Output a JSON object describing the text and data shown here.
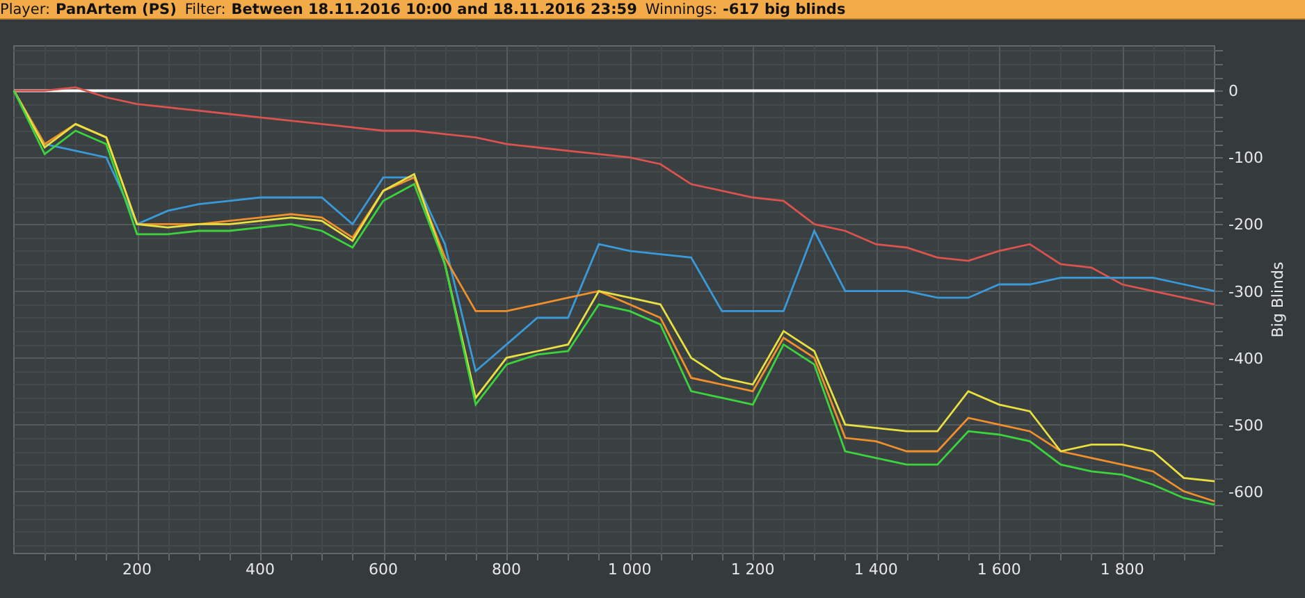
{
  "header": [
    {
      "label": "Player:",
      "value": "PanArtem (PS)"
    },
    {
      "label": "Filter:",
      "value": "Between 18.11.2016 10:00 and 18.11.2016 23:59"
    },
    {
      "label": "Winnings:",
      "value": "-617 big blinds"
    }
  ],
  "chart_data": {
    "type": "line",
    "grid": true,
    "ylabel": "Big Blinds",
    "xlim": [
      0,
      1950
    ],
    "ylim": [
      -693,
      67
    ],
    "xticks": [
      {
        "value": 200,
        "label": "200"
      },
      {
        "value": 400,
        "label": "400"
      },
      {
        "value": 600,
        "label": "600"
      },
      {
        "value": 800,
        "label": "800"
      },
      {
        "value": 1000,
        "label": "1 000"
      },
      {
        "value": 1200,
        "label": "1 200"
      },
      {
        "value": 1400,
        "label": "1 400"
      },
      {
        "value": 1600,
        "label": "1 600"
      },
      {
        "value": 1800,
        "label": "1 800"
      }
    ],
    "yticks": [
      0,
      -100,
      -200,
      -300,
      -400,
      -500,
      -600
    ],
    "x": [
      0,
      50,
      100,
      150,
      200,
      250,
      300,
      350,
      400,
      450,
      500,
      550,
      600,
      650,
      700,
      750,
      800,
      850,
      900,
      950,
      1000,
      1050,
      1100,
      1150,
      1200,
      1250,
      1300,
      1350,
      1400,
      1450,
      1500,
      1550,
      1600,
      1650,
      1700,
      1750,
      1800,
      1850,
      1900,
      1950
    ],
    "series": [
      {
        "color": "#ffffff",
        "values": [
          0,
          0,
          0,
          0,
          0,
          0,
          0,
          0,
          0,
          0,
          0,
          0,
          0,
          0,
          0,
          0,
          0,
          0,
          0,
          0,
          0,
          0,
          0,
          0,
          0,
          0,
          0,
          0,
          0,
          0,
          0,
          0,
          0,
          0,
          0,
          0,
          0,
          0,
          0,
          0
        ]
      },
      {
        "color": "#d9534f",
        "values": [
          0,
          0,
          5,
          -10,
          -20,
          -25,
          -30,
          -35,
          -40,
          -45,
          -50,
          -55,
          -60,
          -60,
          -65,
          -70,
          -80,
          -85,
          -90,
          -95,
          -100,
          -110,
          -140,
          -150,
          -160,
          -165,
          -200,
          -210,
          -230,
          -235,
          -250,
          -255,
          -240,
          -230,
          -260,
          -265,
          -290,
          -300,
          -310,
          -320
        ]
      },
      {
        "color": "#3a9ad9",
        "values": [
          0,
          -80,
          -90,
          -100,
          -200,
          -180,
          -170,
          -165,
          -160,
          -160,
          -160,
          -200,
          -130,
          -130,
          -230,
          -420,
          -380,
          -340,
          -340,
          -230,
          -240,
          -245,
          -250,
          -330,
          -330,
          -330,
          -210,
          -300,
          -300,
          -300,
          -310,
          -310,
          -290,
          -290,
          -280,
          -280,
          -280,
          -280,
          -290,
          -300
        ]
      },
      {
        "color": "#f0902a",
        "values": [
          0,
          -80,
          -50,
          -70,
          -200,
          -200,
          -200,
          -195,
          -190,
          -185,
          -190,
          -220,
          -150,
          -130,
          -250,
          -330,
          -330,
          -320,
          -310,
          -300,
          -320,
          -340,
          -430,
          -440,
          -450,
          -370,
          -400,
          -520,
          -525,
          -540,
          -540,
          -490,
          -500,
          -510,
          -540,
          -550,
          -560,
          -570,
          -600,
          -615
        ]
      },
      {
        "color": "#e8e040",
        "values": [
          0,
          -85,
          -50,
          -70,
          -200,
          -205,
          -200,
          -200,
          -195,
          -190,
          -195,
          -225,
          -150,
          -125,
          -260,
          -460,
          -400,
          -390,
          -380,
          -300,
          -310,
          -320,
          -400,
          -430,
          -440,
          -360,
          -390,
          -500,
          -505,
          -510,
          -510,
          -450,
          -470,
          -480,
          -540,
          -530,
          -530,
          -540,
          -580,
          -585
        ]
      },
      {
        "color": "#3cd43c",
        "values": [
          0,
          -95,
          -60,
          -80,
          -215,
          -215,
          -210,
          -210,
          -205,
          -200,
          -210,
          -235,
          -165,
          -140,
          -260,
          -470,
          -410,
          -395,
          -390,
          -320,
          -330,
          -350,
          -450,
          -460,
          -470,
          -380,
          -410,
          -540,
          -550,
          -560,
          -560,
          -510,
          -515,
          -525,
          -560,
          -570,
          -575,
          -590,
          -610,
          -620
        ]
      }
    ]
  }
}
